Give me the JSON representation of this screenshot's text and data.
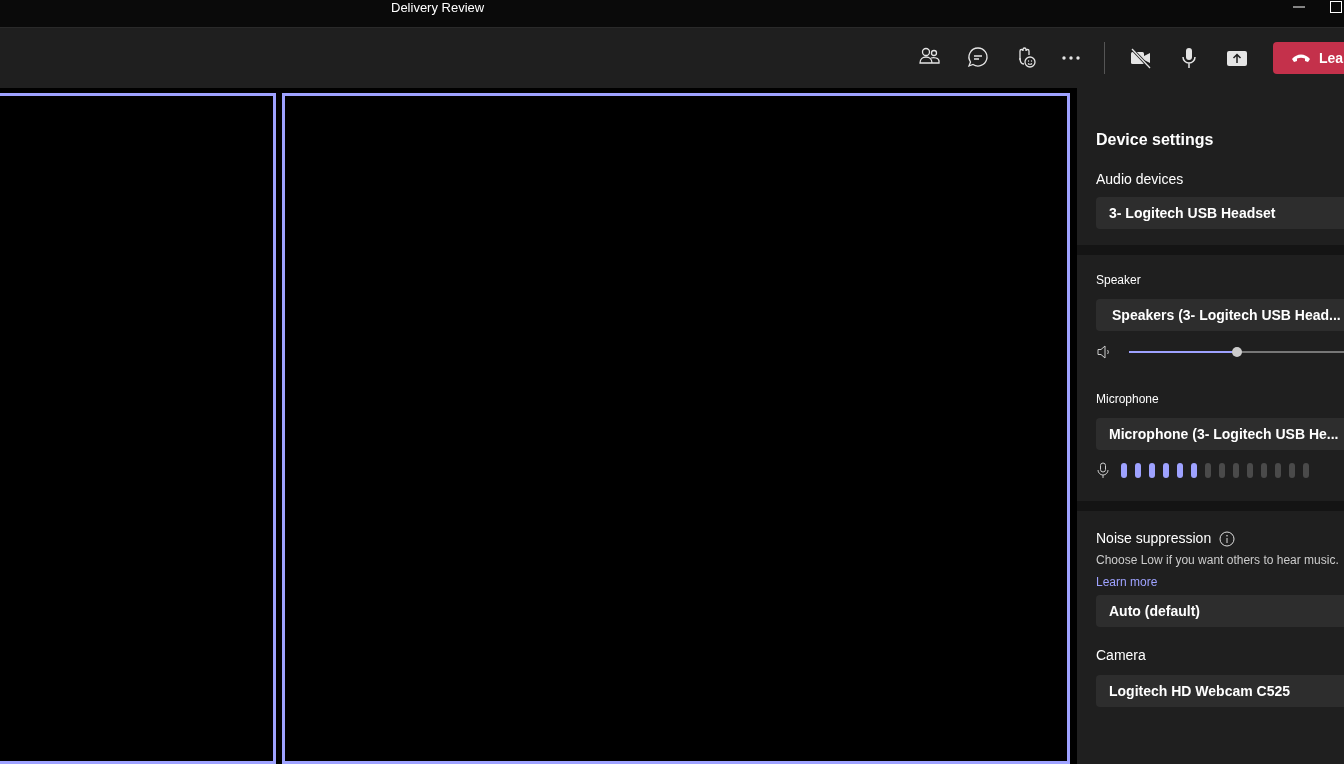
{
  "window": {
    "title": "Delivery Review"
  },
  "toolbar": {
    "leave_label": "Lea",
    "camera_off": true
  },
  "video_tiles": [
    {
      "selected": true
    },
    {
      "selected": true
    }
  ],
  "device_settings": {
    "title": "Device settings",
    "audio_devices": {
      "label": "Audio devices",
      "value": "3- Logitech USB Headset"
    },
    "speaker": {
      "label": "Speaker",
      "value": "Speakers (3- Logitech USB Head...",
      "level": 0.5
    },
    "microphone": {
      "label": "Microphone",
      "value": "Microphone (3- Logitech USB He...",
      "level": 0.43
    },
    "noise_suppression": {
      "label": "Noise suppression",
      "hint": "Choose Low if you want others to hear music.",
      "link": "Learn more",
      "value": "Auto (default)"
    },
    "camera": {
      "label": "Camera",
      "value": "Logitech HD Webcam C525"
    }
  }
}
